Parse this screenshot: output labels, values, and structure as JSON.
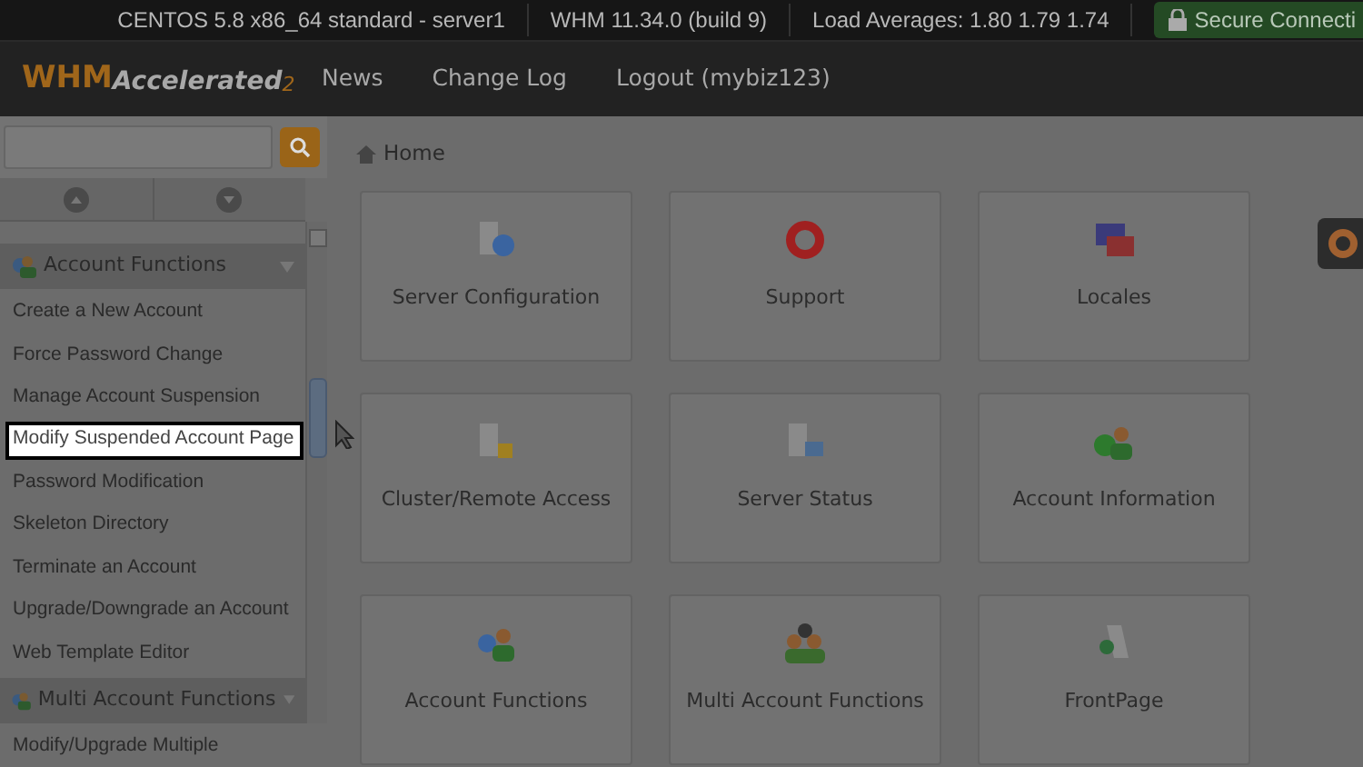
{
  "top_bar": {
    "items": [
      "CENTOS 5.8 x86_64 standard - server1",
      "WHM 11.34.0 (build 9)",
      "Load Averages: 1.80 1.79 1.74"
    ],
    "secure": "Secure Connecti"
  },
  "header": {
    "logo": "WHM",
    "logo_sub": "Accelerated",
    "logo_num": "2",
    "nav": [
      "News",
      "Change Log",
      "Logout (mybiz123)"
    ]
  },
  "breadcrumb": "Home",
  "sidebar": {
    "groups": [
      {
        "title": "Account Functions",
        "items": [
          {
            "label": "Create a New Account",
            "selected": false
          },
          {
            "label": "Force Password Change",
            "selected": false
          },
          {
            "label": "Manage Account Suspension",
            "selected": false
          },
          {
            "label": "Modify Suspended Account Page",
            "selected": true
          },
          {
            "label": "Password Modification",
            "selected": false
          },
          {
            "label": "Skeleton Directory",
            "selected": false
          },
          {
            "label": "Terminate an Account",
            "selected": false
          },
          {
            "label": "Upgrade/Downgrade an Account",
            "selected": false
          },
          {
            "label": "Web Template Editor",
            "selected": false
          }
        ]
      },
      {
        "title": "Multi Account Functions",
        "items": [
          {
            "label": "Modify/Upgrade Multiple",
            "selected": false
          }
        ]
      }
    ]
  },
  "tiles": [
    "Server Configuration",
    "Support",
    "Locales",
    "Cluster/Remote Access",
    "Server Status",
    "Account Information",
    "Account Functions",
    "Multi Account Functions",
    "FrontPage"
  ]
}
